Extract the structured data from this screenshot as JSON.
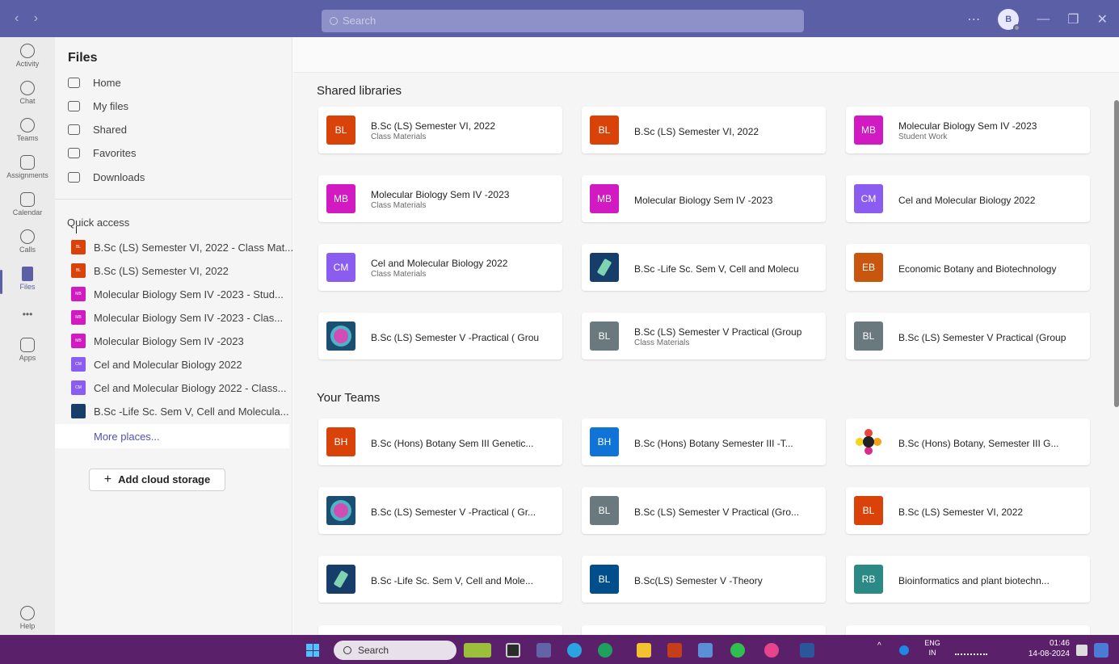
{
  "titlebar": {
    "search_placeholder": "Search",
    "avatar_initials": "B",
    "more": "⋯",
    "minimize": "—",
    "restore": "❐",
    "close": "✕",
    "back": "‹",
    "forward": "›"
  },
  "rail": {
    "activity": "Activity",
    "chat": "Chat",
    "teams": "Teams",
    "assignments": "Assignments",
    "calendar": "Calendar",
    "calls": "Calls",
    "files": "Files",
    "more": "•••",
    "apps": "Apps",
    "help": "Help"
  },
  "files_pane": {
    "title": "Files",
    "nav": [
      "Home",
      "My files",
      "Shared",
      "Favorites",
      "Downloads"
    ],
    "quick_access_title": "Quick access",
    "quick_access": [
      {
        "label": "B.Sc (LS) Semester VI, 2022 - Class Mat...",
        "badge": "BL",
        "color": "#d9430a"
      },
      {
        "label": "B.Sc (LS) Semester VI, 2022",
        "badge": "BL",
        "color": "#d9430a"
      },
      {
        "label": "Molecular Biology Sem IV -2023 - Stud...",
        "badge": "MB",
        "color": "#d11ac1"
      },
      {
        "label": "Molecular Biology Sem IV -2023 - Clas...",
        "badge": "MB",
        "color": "#d11ac1"
      },
      {
        "label": "Molecular Biology Sem IV -2023",
        "badge": "MB",
        "color": "#d11ac1"
      },
      {
        "label": "Cel and Molecular Biology 2022",
        "badge": "CM",
        "color": "#8b5cf0"
      },
      {
        "label": "Cel and Molecular Biology 2022 - Class...",
        "badge": "CM",
        "color": "#8b5cf0"
      },
      {
        "label": "B.Sc -Life Sc. Sem V, Cell and Molecula...",
        "badge": "",
        "color": "#173e6a"
      }
    ],
    "more_places": "More places...",
    "add_cloud": "Add cloud storage",
    "add_cloud_icon": "+"
  },
  "main": {
    "shared_title": "Shared libraries",
    "shared": [
      {
        "badge": "BL",
        "color": "#d9430a",
        "title": "B.Sc (LS) Semester VI, 2022",
        "sub": "Class Materials"
      },
      {
        "badge": "BL",
        "color": "#d9430a",
        "title": "B.Sc (LS) Semester VI, 2022",
        "sub": ""
      },
      {
        "badge": "MB",
        "color": "#d11ac1",
        "title": "Molecular Biology Sem IV -2023",
        "sub": "Student Work"
      },
      {
        "badge": "MB",
        "color": "#d11ac1",
        "title": "Molecular Biology Sem IV -2023",
        "sub": "Class Materials"
      },
      {
        "badge": "MB",
        "color": "#d11ac1",
        "title": "Molecular Biology Sem IV -2023",
        "sub": ""
      },
      {
        "badge": "CM",
        "color": "#8b5cf0",
        "title": "Cel and Molecular Biology 2022",
        "sub": ""
      },
      {
        "badge": "CM",
        "color": "#8b5cf0",
        "title": "Cel and Molecular Biology 2022",
        "sub": "Class Materials"
      },
      {
        "badge": "",
        "logo": "scope",
        "color": "#173e6a",
        "title": "B.Sc -Life Sc. Sem V, Cell and Molecu",
        "sub": ""
      },
      {
        "badge": "EB",
        "color": "#c9560f",
        "title": "Economic Botany and Biotechnology",
        "sub": ""
      },
      {
        "badge": "",
        "logo": "img",
        "color": "#1b4f72",
        "title": "B.Sc (LS) Semester V -Practical ( Grou",
        "sub": ""
      },
      {
        "badge": "BL",
        "color": "#69797e",
        "title": "B.Sc (LS) Semester V Practical (Group",
        "sub": "Class Materials"
      },
      {
        "badge": "BL",
        "color": "#69797e",
        "title": "B.Sc (LS) Semester V Practical (Group",
        "sub": ""
      }
    ],
    "teams_title": "Your Teams",
    "teams": [
      {
        "badge": "BH",
        "color": "#d9430a",
        "title": "B.Sc (Hons) Botany Sem III Genetic...",
        "sub": ""
      },
      {
        "badge": "BH",
        "color": "#0f74d6",
        "title": "B.Sc (Hons) Botany Semester III -T...",
        "sub": ""
      },
      {
        "badge": "",
        "logo": "flower",
        "color": "#ffffff",
        "title": "B.Sc (Hons) Botany, Semester III G...",
        "sub": ""
      },
      {
        "badge": "",
        "logo": "img",
        "color": "#1b4f72",
        "title": "B.Sc (LS) Semester V -Practical ( Gr...",
        "sub": ""
      },
      {
        "badge": "BL",
        "color": "#69797e",
        "title": "B.Sc (LS) Semester V Practical (Gro...",
        "sub": ""
      },
      {
        "badge": "BL",
        "color": "#d9430a",
        "title": "B.Sc (LS) Semester VI, 2022",
        "sub": ""
      },
      {
        "badge": "",
        "logo": "scope",
        "color": "#173e6a",
        "title": "B.Sc -Life Sc. Sem V, Cell and Mole...",
        "sub": ""
      },
      {
        "badge": "BL",
        "color": "#004e8c",
        "title": "B.Sc(LS) Semester V -Theory",
        "sub": ""
      },
      {
        "badge": "RB",
        "color": "#2b8a86",
        "title": "Bioinformatics and plant biotechn...",
        "sub": ""
      }
    ]
  },
  "taskbar": {
    "search": "Search",
    "lang_top": "ENG",
    "lang_bottom": "IN",
    "time": "01:46",
    "date": "14-08-2024",
    "chevron": "^"
  }
}
